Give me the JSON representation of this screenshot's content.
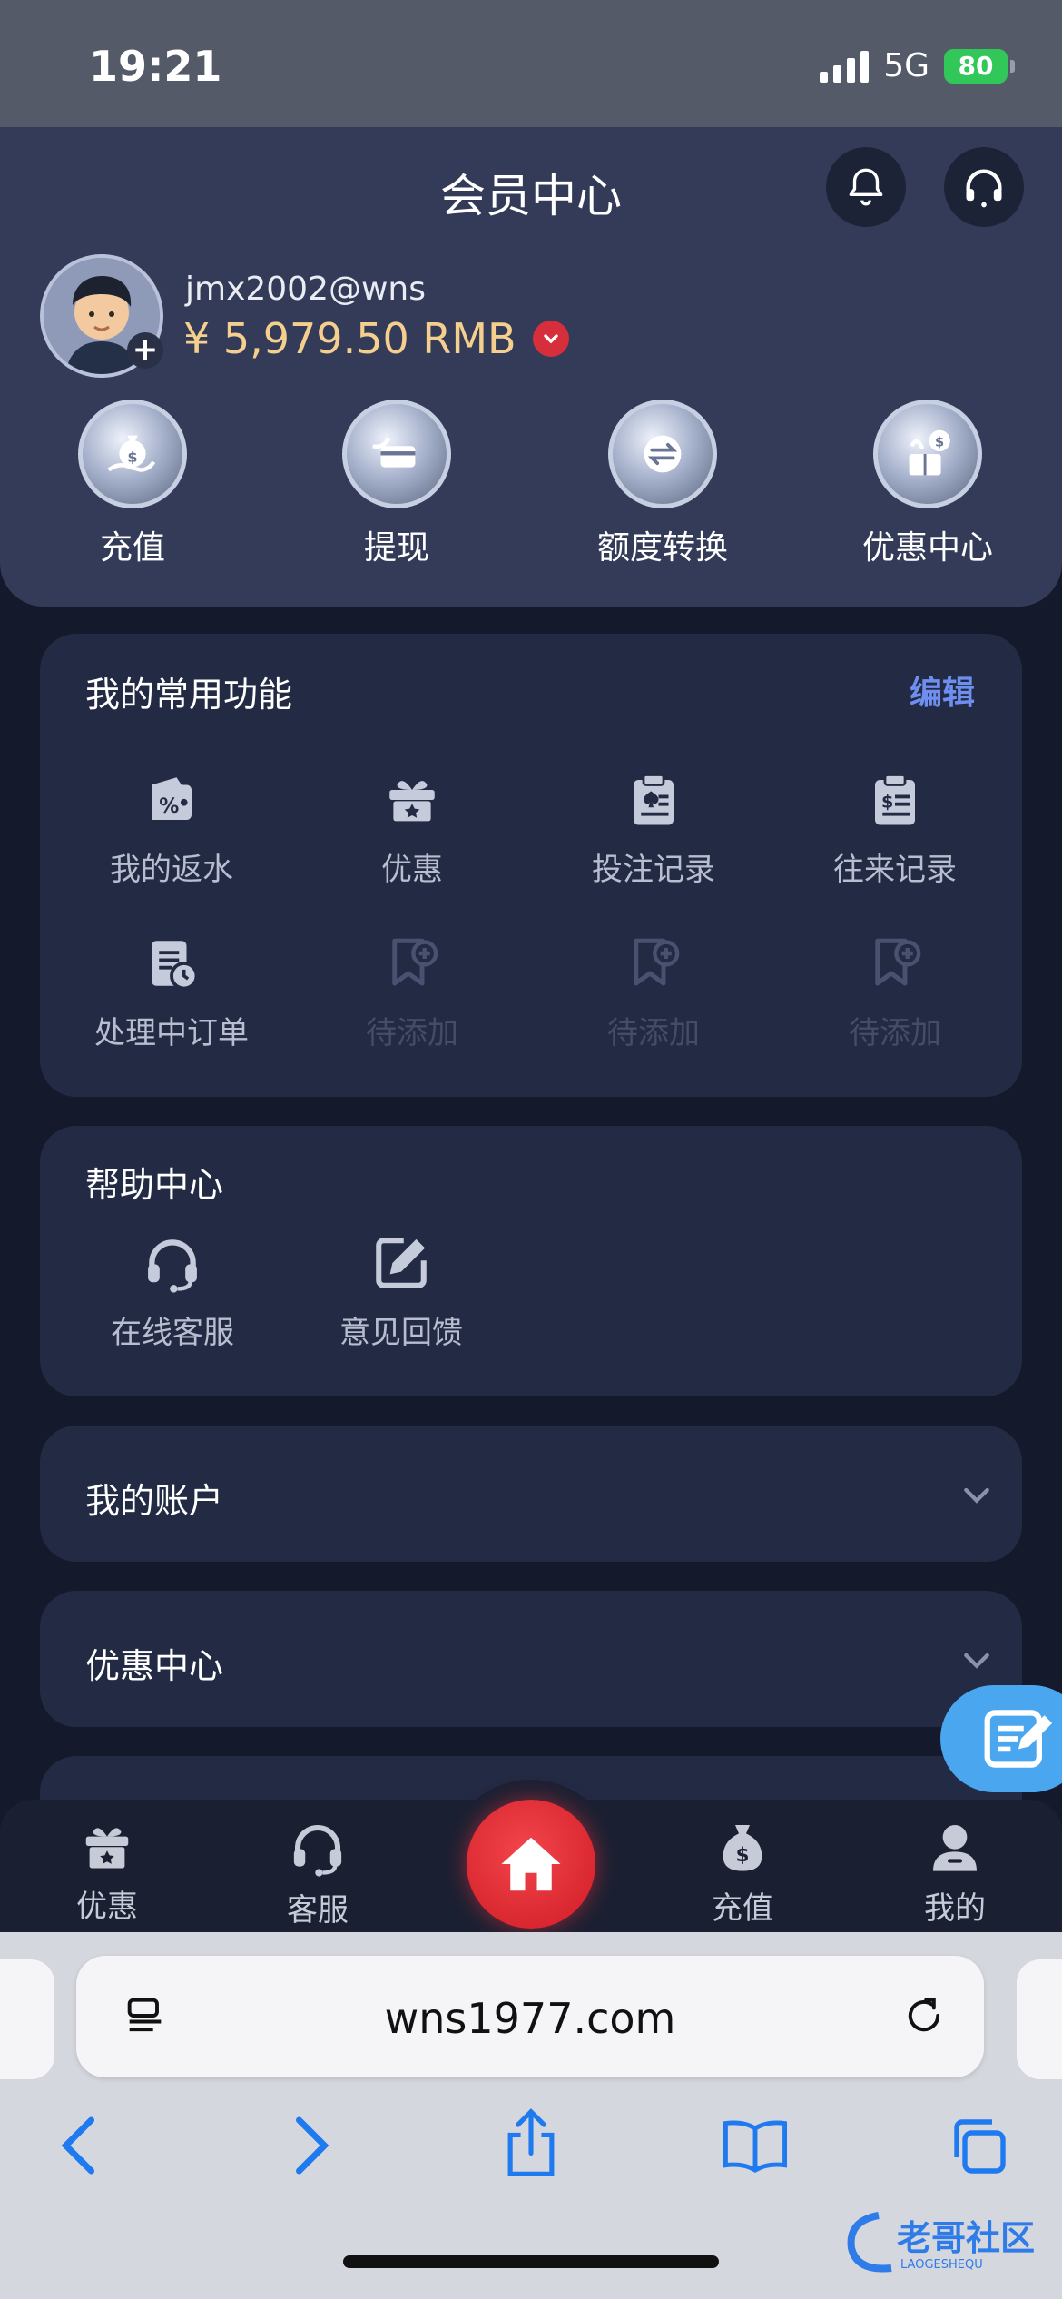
{
  "status_bar": {
    "time": "19:21",
    "network": "5G",
    "battery": "80"
  },
  "header": {
    "title": "会员中心",
    "username": "jmx2002@wns",
    "balance": "¥ 5,979.50 RMB",
    "quick_actions": [
      {
        "label": "充值",
        "icon": "money-bag-hand-icon"
      },
      {
        "label": "提现",
        "icon": "card-hand-icon"
      },
      {
        "label": "额度转换",
        "icon": "transfer-icon"
      },
      {
        "label": "优惠中心",
        "icon": "gift-coin-icon"
      }
    ]
  },
  "common_functions": {
    "title": "我的常用功能",
    "edit_label": "编辑",
    "items": [
      {
        "label": "我的返水",
        "icon": "wallet-percent-icon",
        "enabled": true
      },
      {
        "label": "优惠",
        "icon": "gift-star-icon",
        "enabled": true
      },
      {
        "label": "投注记录",
        "icon": "clipboard-spade-icon",
        "enabled": true
      },
      {
        "label": "往来记录",
        "icon": "clipboard-dollar-icon",
        "enabled": true
      },
      {
        "label": "处理中订单",
        "icon": "document-clock-icon",
        "enabled": true
      },
      {
        "label": "待添加",
        "icon": "bookmark-plus-icon",
        "enabled": false
      },
      {
        "label": "待添加",
        "icon": "bookmark-plus-icon",
        "enabled": false
      },
      {
        "label": "待添加",
        "icon": "bookmark-plus-icon",
        "enabled": false
      }
    ]
  },
  "help_center": {
    "title": "帮助中心",
    "items": [
      {
        "label": "在线客服",
        "icon": "headset-icon"
      },
      {
        "label": "意见回馈",
        "icon": "edit-square-icon"
      }
    ]
  },
  "sections": [
    {
      "title": "我的账户"
    },
    {
      "title": "优惠中心"
    }
  ],
  "tabbar": {
    "items": [
      {
        "label": "优惠",
        "icon": "gift-icon"
      },
      {
        "label": "客服",
        "icon": "headset-icon"
      },
      {
        "label": "",
        "icon": "home-icon"
      },
      {
        "label": "充值",
        "icon": "money-bag-icon"
      },
      {
        "label": "我的",
        "icon": "user-icon"
      }
    ]
  },
  "browser": {
    "url": "wns1977.com"
  },
  "watermark": {
    "text": "老哥社区",
    "subtext": "LAOGESHEQU"
  },
  "colors": {
    "header_bg": "#333b58",
    "card_bg": "#232a43",
    "accent_gold": "#f4cf8e",
    "accent_link": "#6f8ff0",
    "home_red": "#e0252f",
    "fab_blue": "#4aa6ef"
  }
}
